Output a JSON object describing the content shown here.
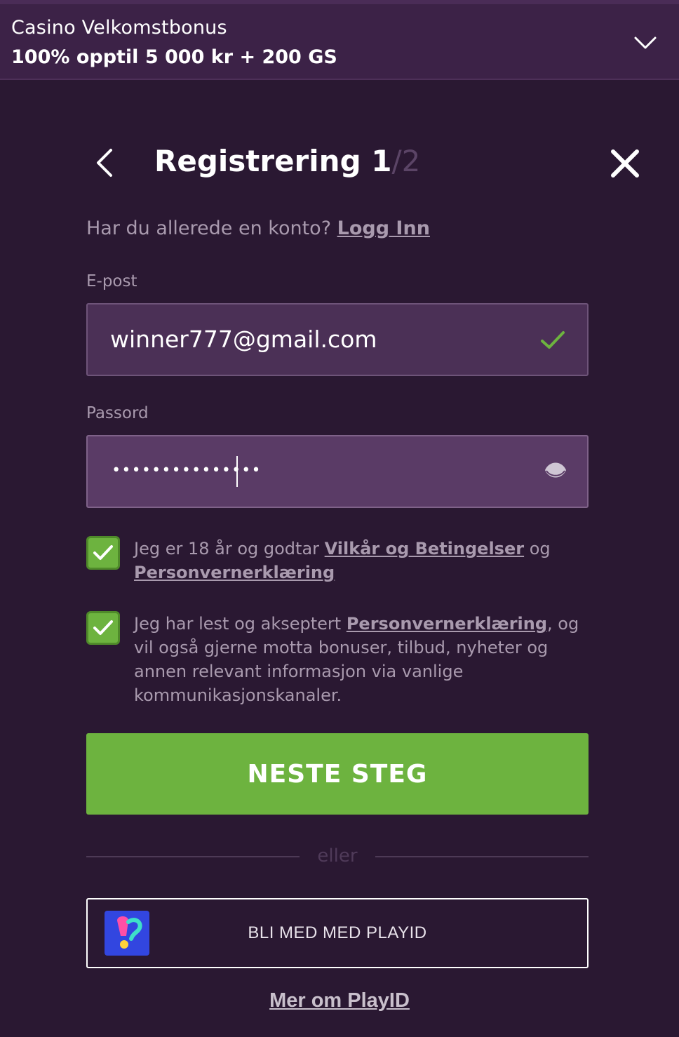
{
  "banner": {
    "title": "Casino Velkomstbonus",
    "subtitle": "100% opptil 5 000 kr + 200 GS",
    "expand_icon": "chevron-down-icon"
  },
  "header": {
    "back_icon": "chevron-left-icon",
    "title": "Registrering",
    "step_current": "1",
    "step_total": "/2",
    "close_icon": "close-icon"
  },
  "login": {
    "prompt": "Har du allerede en konto?",
    "link": "Logg Inn"
  },
  "email": {
    "label": "E-post",
    "value": "winner777@gmail.com",
    "status_icon": "checkmark-icon"
  },
  "password": {
    "label": "Passord",
    "masked_value": "•••••••••••••••",
    "toggle_icon": "eye-icon"
  },
  "consents": [
    {
      "checked": true,
      "text_before": "Jeg er 18 år og godtar ",
      "link1": "Vilkår og Betingelser",
      "text_mid": " og ",
      "link2": "Personvernerklæring"
    },
    {
      "checked": true,
      "text_before": "Jeg har lest og akseptert ",
      "link1": "Personvernerklæring",
      "text_after": ", og vil også gjerne motta bonuser, tilbud, nyheter og annen relevant informasjon via vanlige kommunikasjonskanaler."
    }
  ],
  "next_button": "NESTE STEG",
  "divider_text": "eller",
  "playid": {
    "button_label": "BLI MED MED PLAYID",
    "more_link": "Mer om PlayID",
    "logo_icon": "playid-logo-icon"
  },
  "colors": {
    "background": "#2a1832",
    "banner": "#3c2247",
    "accent_green": "#6db33f",
    "input_bg": "#4b3056",
    "muted_text": "#a99aae"
  }
}
